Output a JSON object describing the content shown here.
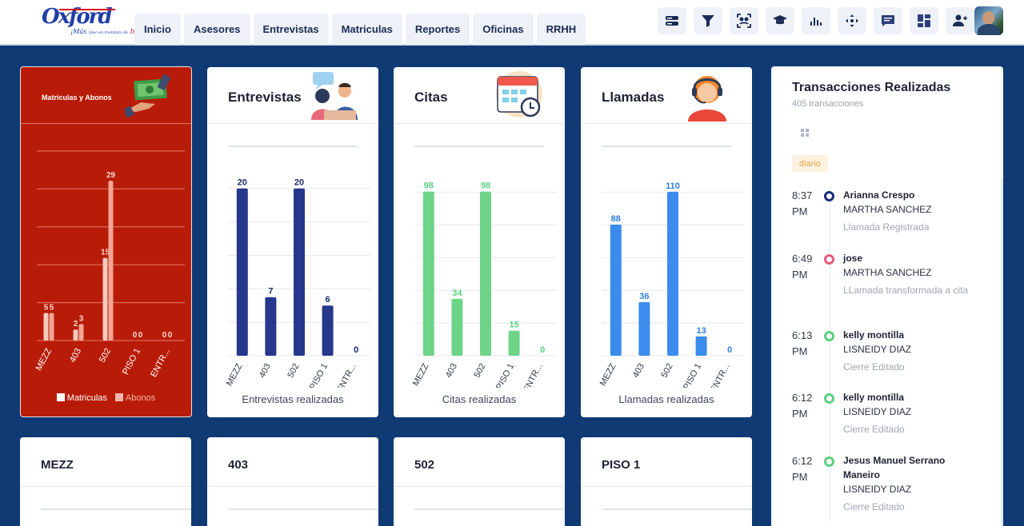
{
  "logo": {
    "main": "Oxford",
    "sub_prefix": "¡Más",
    "sub_small": "Que un Instituto de",
    "sub_red": "Inglés!"
  },
  "nav": {
    "tabs": [
      "Inicio",
      "Asesores",
      "Entrevistas",
      "Matriculas",
      "Reportes",
      "Oficinas",
      "RRHH"
    ]
  },
  "toolbar": {
    "icons": [
      "server-icon",
      "filter-icon",
      "face-scan-icon",
      "graduation-cap-icon",
      "bar-chart-icon",
      "move-icon",
      "chat-icon",
      "dashboard-icon",
      "add-user-icon"
    ]
  },
  "colors": {
    "navy_bg": "#0f3a74",
    "red_card": "#b81c08",
    "navy_bar": "#26378c",
    "green_bar": "#6dd488",
    "blue_bar": "#3c8cee",
    "badge_text": "#e3a24a"
  },
  "cards": {
    "matriculas": {
      "title": "Matriculas y Abonos",
      "legend": [
        "Matriculas",
        "Abonos"
      ]
    },
    "entrevistas": {
      "title": "Entrevistas",
      "footer": "Entrevistas realizadas"
    },
    "citas": {
      "title": "Citas",
      "footer": "Citas realizadas"
    },
    "llamadas": {
      "title": "Llamadas",
      "footer": "Llamadas realizadas"
    }
  },
  "chart_data": [
    {
      "type": "bar",
      "title": "Matriculas y Abonos",
      "categories": [
        "MEZZ",
        "403",
        "502",
        "PISO 1",
        "ENTR..."
      ],
      "series": [
        {
          "name": "Matriculas",
          "values": [
            5,
            2,
            15,
            0,
            0
          ]
        },
        {
          "name": "Abonos",
          "values": [
            5,
            3,
            29,
            0,
            0
          ]
        }
      ],
      "ylim": [
        0,
        37
      ],
      "legend": "bottom",
      "grid": true
    },
    {
      "type": "bar",
      "title": "Entrevistas",
      "categories": [
        "MEZZ",
        "403",
        "502",
        "PISO 1",
        "ENTR..."
      ],
      "values": [
        20,
        7,
        20,
        6,
        0
      ],
      "xlabel": "Entrevistas realizadas",
      "ylim": [
        0,
        21.5
      ],
      "grid": true
    },
    {
      "type": "bar",
      "title": "Citas",
      "categories": [
        "MEZZ",
        "403",
        "502",
        "PISO 1",
        "ENTR..."
      ],
      "values": [
        98,
        34,
        98,
        15,
        0
      ],
      "xlabel": "Citas realizadas",
      "ylim": [
        0,
        105
      ],
      "grid": true
    },
    {
      "type": "bar",
      "title": "Llamadas",
      "categories": [
        "MEZZ",
        "403",
        "502",
        "PISO 1",
        "ENTR..."
      ],
      "values": [
        88,
        36,
        110,
        13,
        0
      ],
      "xlabel": "Llamadas realizadas",
      "ylim": [
        0,
        118
      ],
      "grid": true
    }
  ],
  "transactions": {
    "title": "Transacciones Realizadas",
    "count_text": "405 transacciones",
    "badge": "diario",
    "items": [
      {
        "time": "8:37 PM",
        "name": "Arianna Crespo",
        "asesor": "MARTHA SANCHEZ",
        "action": "Llamada Registrada",
        "ring": "#1a2b7a"
      },
      {
        "time": "6:49 PM",
        "name": "jose",
        "asesor": "MARTHA SANCHEZ",
        "action": "LLamada transformada a cita",
        "ring": "#e85a7a"
      },
      {
        "time": "6:13 PM",
        "name": "kelly montilla",
        "asesor": "LISNEIDY DIAZ",
        "action": "Cierre Editado",
        "ring": "#5ccf7e"
      },
      {
        "time": "6:12 PM",
        "name": "kelly montilla",
        "asesor": "LISNEIDY DIAZ",
        "action": "Cierre Editado",
        "ring": "#5ccf7e"
      },
      {
        "time": "6:12 PM",
        "name": "Jesus Manuel Serrano Maneiro",
        "asesor": "LISNEIDY DIAZ",
        "action": "Cierre Editado",
        "ring": "#5ccf7e"
      }
    ]
  },
  "bottom_cards": [
    "MEZZ",
    "403",
    "502",
    "PISO 1"
  ]
}
